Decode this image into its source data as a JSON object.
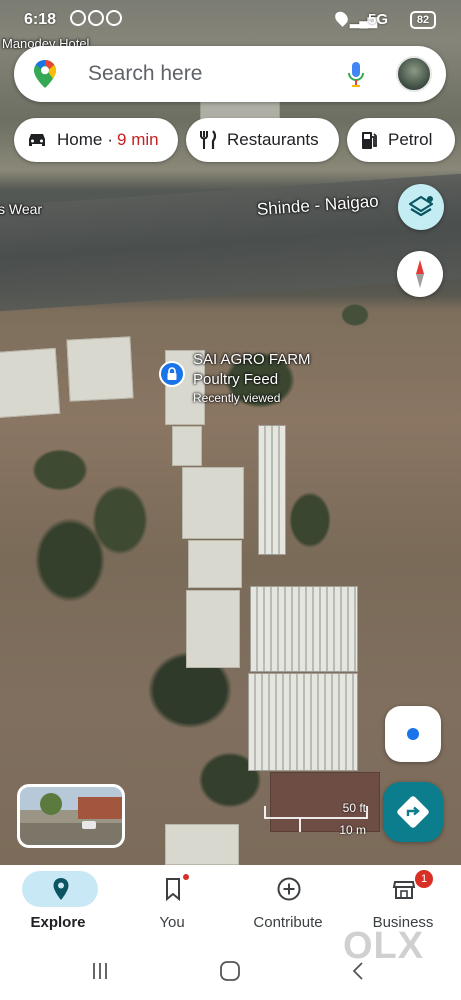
{
  "status_bar": {
    "time": "6:18",
    "network": "5G",
    "battery": "82"
  },
  "search": {
    "placeholder": "Search here"
  },
  "chips": [
    {
      "label": "Home",
      "eta": "9 min",
      "icon": "car-icon"
    },
    {
      "label": "Restaurants",
      "icon": "fork-knife-icon"
    },
    {
      "label": "Petrol",
      "icon": "fuel-pump-icon"
    }
  ],
  "map": {
    "labels": {
      "top_left_partial": "Manodev Hotel",
      "shop_partial": "s Wear",
      "road": "Shinde - Naigao"
    },
    "place": {
      "name_line1": "SAI AGRO FARM",
      "name_line2": "Poultry Feed",
      "subtitle": "Recently viewed"
    },
    "scale": {
      "feet": "50 ft",
      "meters": "10 m"
    }
  },
  "bottom_nav": {
    "items": [
      {
        "label": "Explore",
        "icon": "pin-icon",
        "active": true
      },
      {
        "label": "You",
        "icon": "bookmark-icon"
      },
      {
        "label": "Contribute",
        "icon": "plus-circle-icon"
      },
      {
        "label": "Business",
        "icon": "storefront-icon",
        "badge": "1"
      }
    ]
  },
  "watermark": "OLX",
  "colors": {
    "accent": "#1a73e8",
    "directions": "#0b7d8c",
    "eta": "#c5221f",
    "badge": "#d93025"
  }
}
